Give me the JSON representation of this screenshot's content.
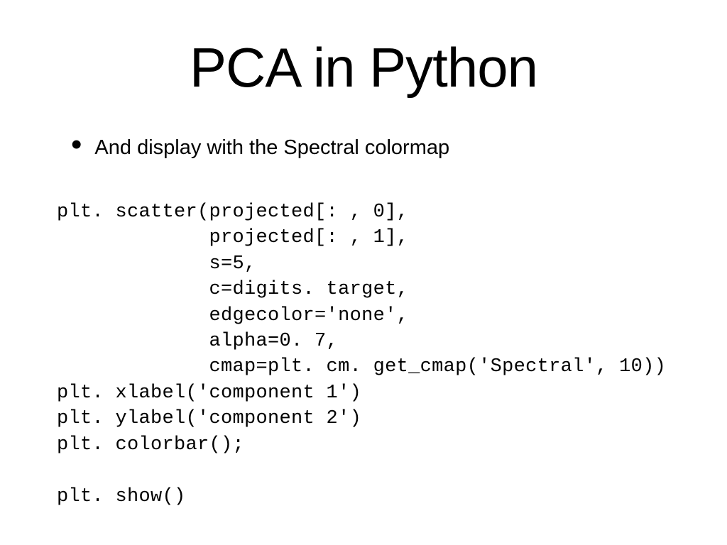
{
  "title": "PCA in Python",
  "bullet": "And display with the Spectral colormap",
  "code": "plt. scatter(projected[: , 0],\n             projected[: , 1],\n             s=5,\n             c=digits. target,\n             edgecolor='none',\n             alpha=0. 7,\n             cmap=plt. cm. get_cmap('Spectral', 10))\nplt. xlabel('component 1')\nplt. ylabel('component 2')\nplt. colorbar();\n\nplt. show()"
}
